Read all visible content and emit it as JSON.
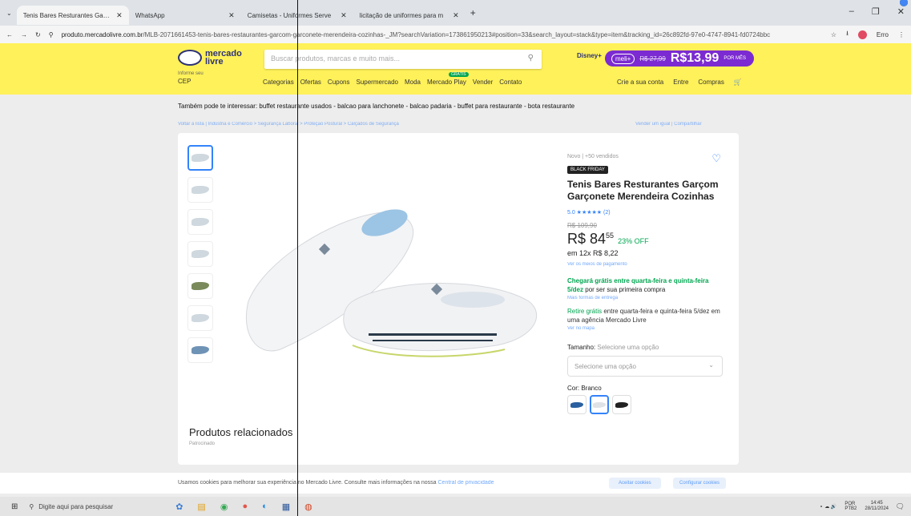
{
  "browser": {
    "tabs": [
      {
        "label": "Tenis Bares Resturantes Garço",
        "color": "#f5b400"
      },
      {
        "label": "WhatsApp",
        "color": "#25d366"
      },
      {
        "label": "Camisetas - Uniformes Serve",
        "color": "#555555"
      },
      {
        "label": "licitação de uniformes para m",
        "color": "#4285f4"
      }
    ],
    "new_tab": "+",
    "url_domain": "produto.mercadolivre.com.br",
    "url_path": "/MLB-2071661453-tenis-bares-restaurantes-garcom-garconete-merendeira-cozinhas-_JM?searchVariation=173861950213#position=33&search_layout=stack&type=item&tracking_id=26c892fd-97e0-4747-8941-fd0724bbc",
    "error_label": "Erro"
  },
  "header": {
    "logo_line1": "mercado",
    "logo_line2": "livre",
    "search_placeholder": "Buscar produtos, marcas e muito mais...",
    "disney": "Disney+",
    "meli_label": "meli+",
    "meli_old": "R$ 27,99",
    "meli_new": "R$13,99",
    "meli_small": "POR MÊS",
    "cep_small": "Informe seu",
    "cep": "CEP",
    "nav": [
      "Categorias",
      "Ofertas",
      "Cupons",
      "Supermercado",
      "Moda",
      "Mercado Play",
      "Vender",
      "Contato"
    ],
    "nav_badge": "GRÁTIS",
    "user": [
      "Crie a sua conta",
      "Entre",
      "Compras"
    ]
  },
  "suggest": "Também pode te interessar: buffet restaurante usados - balcao para lanchonete - balcao padaria - buffet para restaurante - bota restaurante",
  "breadcrumb": "Voltar à lista  |  Indústria e Comércio > Segurança Laboral > Proteção Postural > Calçados de Segurança",
  "breadcrumb_right": "Vender um igual  |  Compartilhar",
  "product": {
    "condition": "Novo  |  +50 vendidos",
    "badge": "BLACK FRIDAY",
    "title": "Tenis Bares Resturantes Garçom Garçonete Merendeira Cozinhas",
    "rating": "5.0 ★★★★★ (2)",
    "old_price": "R$ 109,90",
    "price": "R$ 84",
    "price_cents": "55",
    "discount": "23% OFF",
    "installments": "em 12x R$ 8,22",
    "payment_link": "Ver os meios de pagamento",
    "ship_green": "Chegará grátis entre quarta-feira e quinta-feira 5/dez",
    "ship_rest": " por ser sua primeira compra",
    "ship_link": "Mais formas de entrega",
    "pickup_green": "Retire grátis",
    "pickup_rest": " entre quarta-feira e quinta-feira 5/dez em uma agência Mercado Livre",
    "map_link": "Ver no mapa",
    "size_label": "Tamanho:",
    "size_hint": "Selecione uma opção",
    "size_placeholder": "Selecione uma opção",
    "color_label": "Cor: Branco"
  },
  "related": {
    "title": "Produtos relacionados",
    "sub": "Patrocinado"
  },
  "cookie": {
    "msg": "Usamos cookies para melhorar sua experiência no Mercado Livre. Consulte mais informações na nossa",
    "link": "Central de privacidade",
    "accept": "Aceitar cookies",
    "config": "Configurar cookies"
  },
  "taskbar": {
    "search": "Digite aqui para pesquisar",
    "lang": "POR",
    "lang2": "PTB2",
    "time": "14:45",
    "date": "28/11/2024"
  }
}
